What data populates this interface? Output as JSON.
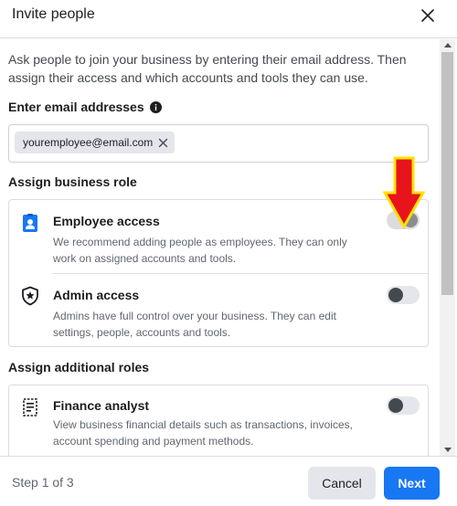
{
  "dialog": {
    "title": "Invite people",
    "intro": "Ask people to join your business by entering their email address. Then assign their access and which accounts and tools they can use.",
    "email_label": "Enter email addresses",
    "email_chip": "youremployee@email.com"
  },
  "business_roles": {
    "heading": "Assign business role",
    "items": [
      {
        "title": "Employee access",
        "description": "We recommend adding people as employees. They can only work on assigned accounts and tools.",
        "icon": "employee-badge-icon",
        "toggle_on": true
      },
      {
        "title": "Admin access",
        "description": "Admins have full control over your business. They can edit settings, people, accounts and tools.",
        "icon": "shield-star-icon",
        "toggle_on": false
      }
    ]
  },
  "additional_roles": {
    "heading": "Assign additional roles",
    "items": [
      {
        "title": "Finance analyst",
        "description": "View business financial details such as transactions, invoices, account spending and payment methods.",
        "icon": "finance-document-icon",
        "toggle_on": false
      }
    ]
  },
  "footer": {
    "step": "Step 1 of 3",
    "cancel": "Cancel",
    "next": "Next"
  },
  "colors": {
    "primary": "#1877f2",
    "arrow_fill": "#e8141b",
    "arrow_outline": "#ffe100",
    "icon_blue": "#1877f2"
  }
}
